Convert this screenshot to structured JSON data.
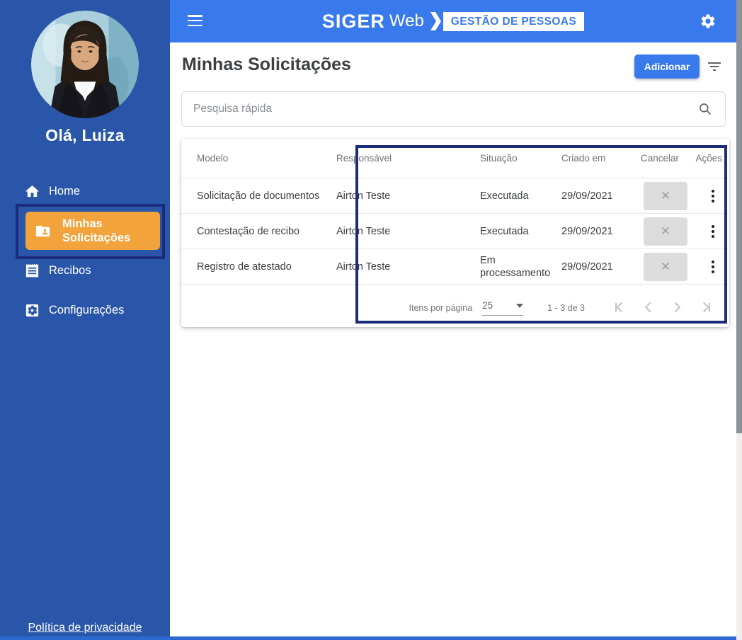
{
  "colors": {
    "header_blue": "#3879EC",
    "sidebar_blue": "#2956A8",
    "active_orange": "#F2A33C",
    "annotation_navy": "#1B2D7A",
    "bottom_strip_blue": "#2B68D0",
    "badge_bg": "#FFFFFF",
    "cancel_btn_bg": "#DCDCDC"
  },
  "header": {
    "logo_primary": "SIGER",
    "logo_secondary": "Web",
    "logo_badge": "GESTÃO DE PESSOAS",
    "icons": [
      "menu-icon",
      "settings-gear-icon"
    ]
  },
  "sidebar": {
    "greeting": "Olá, Luiza",
    "items": [
      {
        "label": "Home",
        "icon": "home-icon",
        "active": false
      },
      {
        "label": "Minhas Solicitações",
        "icon": "folder-shared-icon",
        "active": true
      },
      {
        "label": "Recibos",
        "icon": "receipt-icon",
        "active": false
      },
      {
        "label": "Configurações",
        "icon": "settings-applications-icon",
        "active": false
      }
    ],
    "privacy_link": "Política de privacidade"
  },
  "main": {
    "title": "Minhas Solicitações",
    "add_button": "Adicionar",
    "search_placeholder": "Pesquisa rápida",
    "table": {
      "columns": {
        "modelo": "Modelo",
        "responsavel": "Responsável",
        "situacao": "Situação",
        "criado_em": "Criado em",
        "cancelar": "Cancelar",
        "acoes": "Ações"
      },
      "rows": [
        {
          "modelo": "Solicitação de documentos",
          "responsavel": "Airton Teste",
          "situacao": "Executada",
          "criado_em": "29/09/2021"
        },
        {
          "modelo": "Contestação de recibo",
          "responsavel": "Airton Teste",
          "situacao": "Executada",
          "criado_em": "29/09/2021"
        },
        {
          "modelo": "Registro de atestado",
          "responsavel": "Airton Teste",
          "situacao": "Em processamento",
          "criado_em": "29/09/2021"
        }
      ],
      "cancel_glyph": "✕"
    },
    "paginator": {
      "items_per_page_label": "Itens por página",
      "items_per_page_value": "25",
      "range_label": "1 - 3 de 3",
      "nav_icons": [
        "first-page-icon",
        "prev-page-icon",
        "next-page-icon",
        "last-page-icon"
      ]
    }
  }
}
